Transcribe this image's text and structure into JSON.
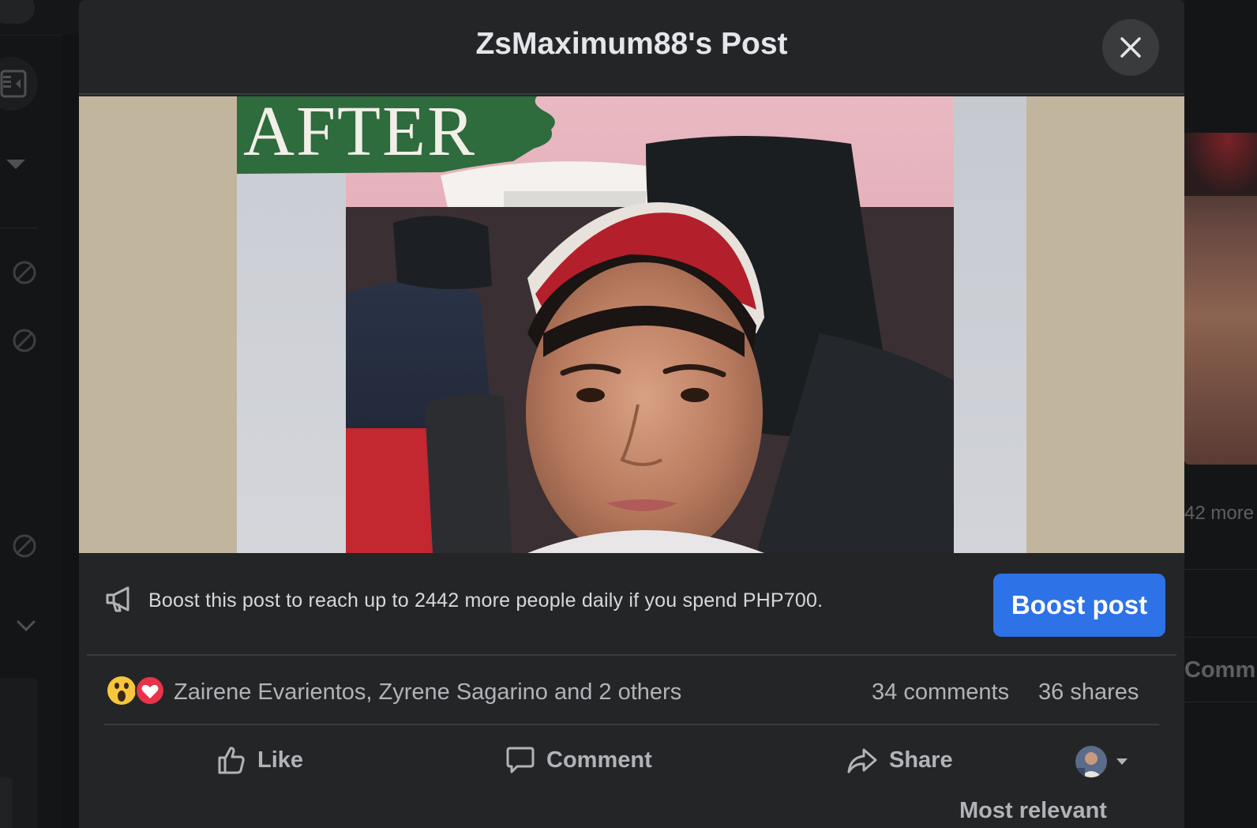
{
  "modal": {
    "title": "ZsMaximum88's Post"
  },
  "photo": {
    "overlay_text": "AFTER"
  },
  "boost": {
    "message": "Boost this post to reach up to 2442 more people daily if you spend PHP700.",
    "button_label": "Boost post",
    "button_color": "#2d72e6"
  },
  "reactions": {
    "icons": [
      "wow-emoji-icon",
      "love-heart-icon"
    ],
    "names": "Zairene Evarientos, Zyrene Sagarino and 2 others",
    "comments": "34 comments",
    "shares": "36 shares"
  },
  "actions": {
    "like_label": "Like",
    "comment_label": "Comment",
    "share_label": "Share"
  },
  "comments_sort": {
    "label": "Most relevant"
  },
  "background": {
    "right_more_text": "42 more",
    "right_comment_text": "Comm"
  }
}
